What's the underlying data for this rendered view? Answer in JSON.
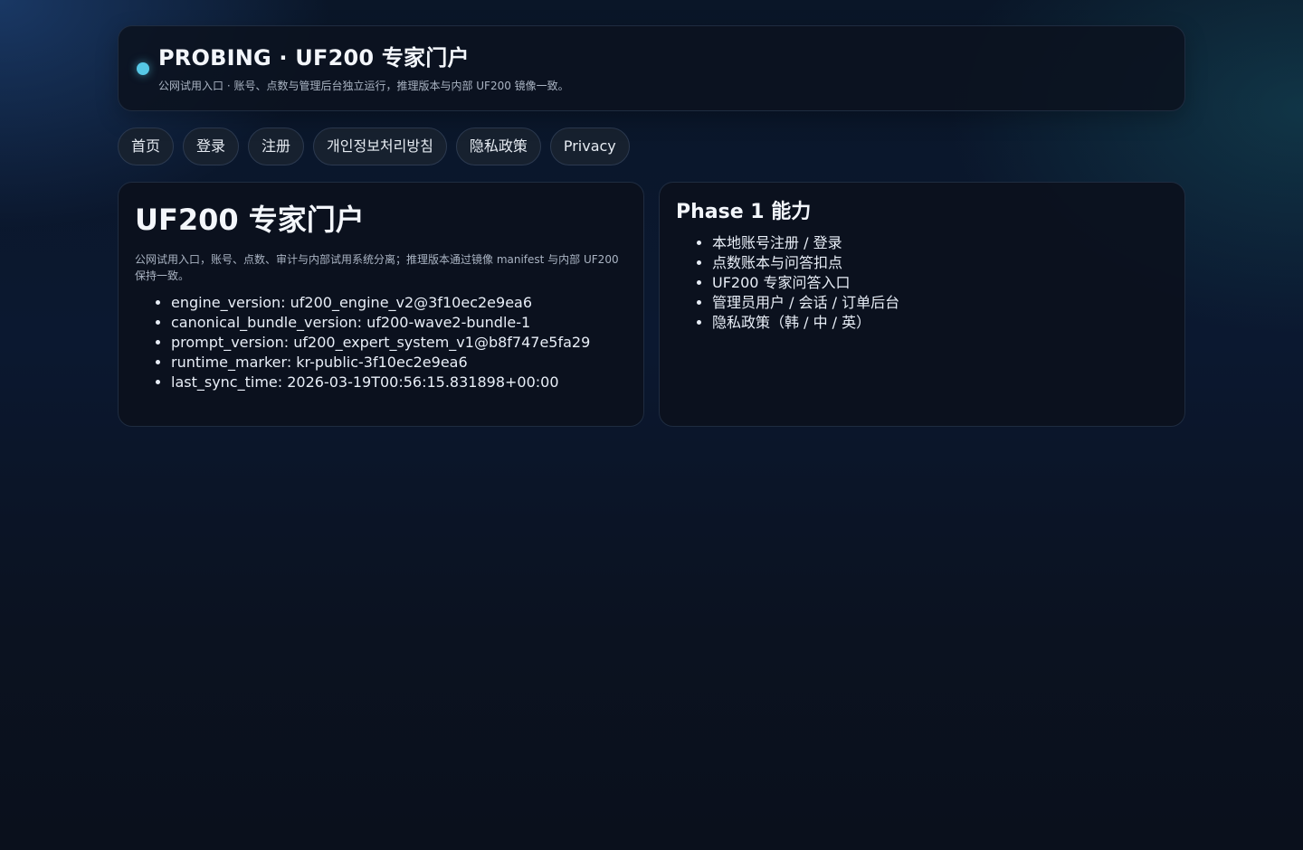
{
  "header": {
    "title": "PROBING · UF200 专家门户",
    "subtitle": "公网试用入口 · 账号、点数与管理后台独立运行，推理版本与内部 UF200 镜像一致。"
  },
  "nav": {
    "items": [
      {
        "label": "首页"
      },
      {
        "label": "登录"
      },
      {
        "label": "注册"
      },
      {
        "label": "개인정보처리방침"
      },
      {
        "label": "隐私政策"
      },
      {
        "label": "Privacy"
      }
    ]
  },
  "left_card": {
    "title": "UF200 专家门户",
    "description": "公网试用入口，账号、点数、审计与内部试用系统分离；推理版本通过镜像 manifest 与内部 UF200 保持一致。",
    "items": [
      "engine_version: uf200_engine_v2@3f10ec2e9ea6",
      "canonical_bundle_version: uf200-wave2-bundle-1",
      "prompt_version: uf200_expert_system_v1@b8f747e5fa29",
      "runtime_marker: kr-public-3f10ec2e9ea6",
      "last_sync_time: 2026-03-19T00:56:15.831898+00:00"
    ]
  },
  "right_card": {
    "title": "Phase 1 能力",
    "items": [
      "本地账号注册 / 登录",
      "点数账本与问答扣点",
      "UF200 专家问答入口",
      "管理员用户 / 会话 / 订单后台",
      "隐私政策（韩 / 中 / 英）"
    ]
  },
  "colors": {
    "accent_dot": "#56c8e6",
    "background": "#0b1220",
    "card_border": "#1f2c40"
  }
}
